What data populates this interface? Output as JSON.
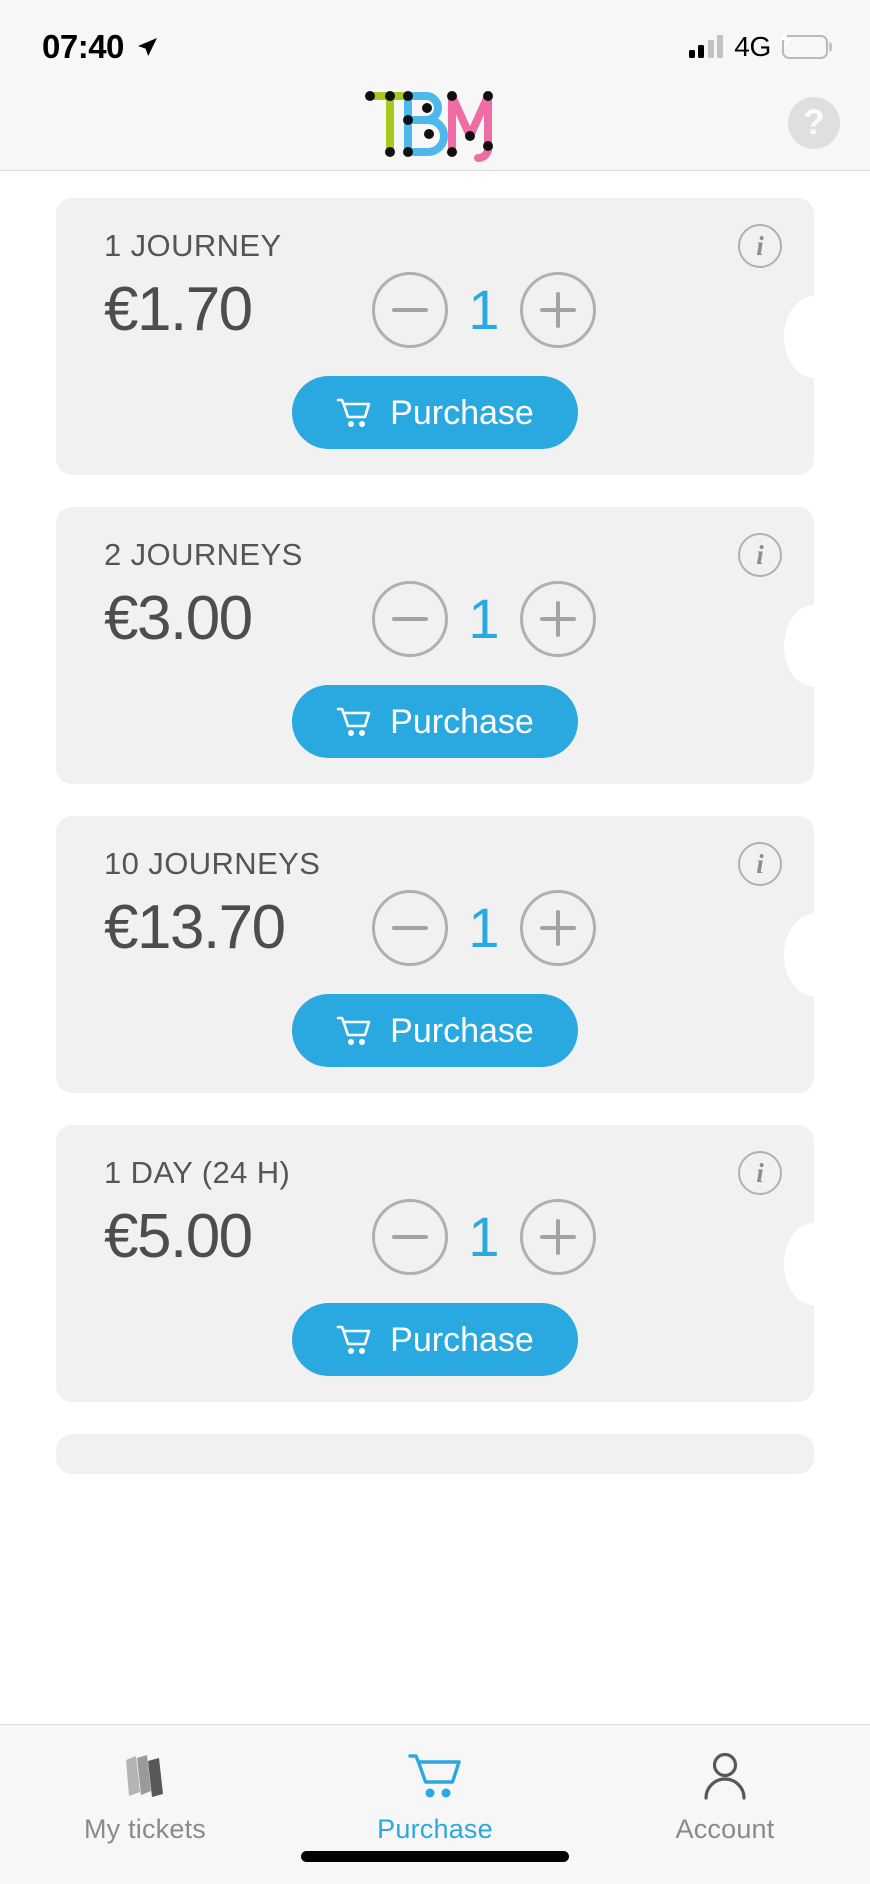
{
  "status_bar": {
    "time": "07:40",
    "location_icon": "location-arrow-icon",
    "network": "4G",
    "signal_icon": "signal-bars-icon",
    "battery_icon": "battery-charging-icon"
  },
  "header": {
    "logo_text": "TBM",
    "logo_letters": [
      "T",
      "B",
      "M"
    ],
    "logo_colors": {
      "t": "#a5c91c",
      "b": "#4cb9ea",
      "m": "#ef6ca4",
      "dot": "#101010"
    },
    "help_label": "?"
  },
  "theme": {
    "accent": "#2aa9e0",
    "card_bg": "#f1f1f1",
    "page_bg": "#ffffff",
    "text": "#4d4d4d",
    "muted": "#8a8a8a"
  },
  "tickets": [
    {
      "title": "1 JOURNEY",
      "price": "€1.70",
      "quantity": "1",
      "info_label": "i",
      "decrement_label": "−",
      "increment_label": "+",
      "purchase_label": "Purchase"
    },
    {
      "title": "2 JOURNEYS",
      "price": "€3.00",
      "quantity": "1",
      "info_label": "i",
      "decrement_label": "−",
      "increment_label": "+",
      "purchase_label": "Purchase"
    },
    {
      "title": "10 JOURNEYS",
      "price": "€13.70",
      "quantity": "1",
      "info_label": "i",
      "decrement_label": "−",
      "increment_label": "+",
      "purchase_label": "Purchase"
    },
    {
      "title": "1 DAY (24 H)",
      "price": "€5.00",
      "quantity": "1",
      "info_label": "i",
      "decrement_label": "−",
      "increment_label": "+",
      "purchase_label": "Purchase"
    }
  ],
  "tab_bar": {
    "tabs": [
      {
        "label": "My tickets",
        "icon": "tickets-icon",
        "active": false
      },
      {
        "label": "Purchase",
        "icon": "shopping-cart-icon",
        "active": true
      },
      {
        "label": "Account",
        "icon": "person-icon",
        "active": false
      }
    ]
  }
}
